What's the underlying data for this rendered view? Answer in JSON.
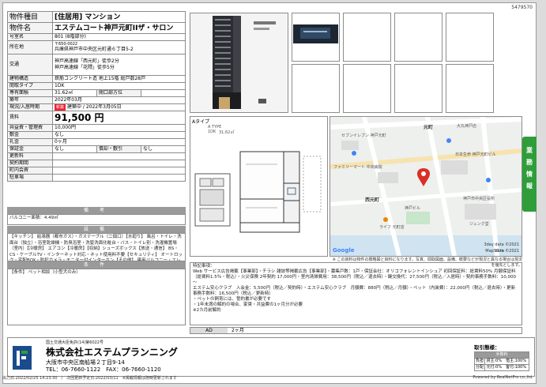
{
  "property_no": "5479570",
  "spec": {
    "type_label": "物件種目",
    "type_value": "[住居用] マンション",
    "name_label": "物件名",
    "name_value": "エステムコート神戸元町IIザ・サロン",
    "room_label": "号室名",
    "room_value": "801 (8階部分)",
    "location_label": "所在地",
    "postal": "〒650-0022",
    "location_value": "兵庫県神戸市中央区元町通６丁目5-2",
    "traffic_label": "交通",
    "traffic_1": "神戸高速線「西元町」徒歩2分",
    "traffic_2": "神戸高速線「花隈」徒歩5分",
    "structure_label": "建物構造",
    "structure_value": "鉄筋コンクリート造 地上15階 総戸数28戸",
    "layout_label": "間取タイプ",
    "layout_value": "1DK",
    "area_label": "専有面積",
    "area_value": "31.62㎡",
    "direction_label": "開口部方位",
    "direction_value": "",
    "built_label": "築年",
    "built_value": "2022年03月",
    "status_label": "現況/入居時期",
    "status_badge": "新築",
    "status_value": "建築中 / 2022年3月05日",
    "rent_label": "賃料",
    "rent_value": "91,500 円",
    "fee_label": "共益費・管理費",
    "fee_value": "10,000円",
    "deposit_label": "敷金",
    "deposit_value": "なし",
    "key_label": "礼金",
    "key_value": "0ヶ月",
    "guarantee_label": "保証金",
    "guarantee_value": "なし",
    "amort_label": "償却・敷引",
    "amort_value": "なし",
    "renewal_label": "更新料",
    "renewal_value": "",
    "contract_label": "契約期間",
    "contract_value": "",
    "neighborhood_label": "町内会費",
    "neighborhood_value": "",
    "parking_label": "駐車場",
    "parking_value": ""
  },
  "sections": {
    "remarks_title": "備 考",
    "remarks_text": "バルコニー面積：4.49㎡",
    "facilities_title": "設 備",
    "facilities_text": "【キッチン】 給湯器（都市ガス）・ガステーブル（二個口）【水廻り】 風呂・トイレ・洗面台（独立）・浴室乾燥機・防臭浴室・洗髪洗面化粧台・バス・トイレ別・洗濯機置場（室内）【冷暖房】 エアコン【冷暖房】【収納】シューズボックス【放送・通信】 BS・CS・ケーブルTV・インターネット対応・ネット使用料不要【セキュリティ】 オートロック・宅配BOX・防犯カメラ・モニター付インターホン【その他】 専用バルコニー・エレベーター・1棟・オートバイ駐輪場・自転車置場・ペット可（小型犬）・電気・ガス（都市ガス）・水道（公営）・抽水・バルコニー／ベランダ・照明・24時間換気システム・分譲タイプ・フローリング",
    "conditions_title": "条 件",
    "conditions_text": "【条件】 ペット相談（小型犬のみ）"
  },
  "floorplan": {
    "label": "Aタイプ",
    "type_caption": "A TYPE",
    "unit": "1DK",
    "area": "31.62㎡"
  },
  "map": {
    "stations": [
      "元町",
      "西元町"
    ],
    "places": [
      "日本生命 神戸元町ビル",
      "セブンイレブン 神戸元町",
      "ファミリーマート 中央病院",
      "大丸神戸店",
      "神戸市中央区役所",
      "ライフ 元町店",
      "ジュンク堂",
      "神戸ビル"
    ],
    "copyright": "Map data ©2021",
    "scale": "50 m",
    "google": "Google",
    "date_note": "3day data ©2021"
  },
  "map_note": "※ この資料は物件の概略図と資料になります。写真、間取図面、設備、概要などが現況と異なる場合は現況を優先とします。",
  "notes": {
    "heading": "特記事項：",
    "lines": [
      "Web サービス広告掲載【事業部】・チラシ 雑誌等掲載広告【事業部】・募集戸数：1戸・保証会社：オリコフォレントインシュア 初回保証料：総賃料50% 月額保証料（総賃料1.5％・税込）・火災保険 2年契約 17,000円・室内清掃費用：38,500円（税込／退去時）・鍵交換代：27,500円（税込／入居時）・契約事務手数料：10,000～",
      "エステム安心クラブ　入会金：5,500円（税込／契約時）・エステム安心クラブ　月額費：880円（税込／月額）・ペット（内装費）：22,000円（税込／退去時）・更新事務手数料：16,500円（税込／更新時）",
      "・ペットの飼育には、誓約書が必要です",
      "・1年未満の解約の場合、家賃・共益費の1ヶ月分が必要",
      "※2カ月前解約"
    ]
  },
  "ad": {
    "label": "AD",
    "value": "2ヶ月"
  },
  "side_tab": [
    "業",
    "務",
    "情",
    "報"
  ],
  "footer": {
    "license": "国土交通大臣免許(14)第6022号",
    "company": "株式会社エステムプランニング",
    "address": "大阪市中央区南船場２丁目9-14",
    "tel": "TEL：06-7660-1122　FAX：06-7660-1120"
  },
  "deal": {
    "title": "取引態様：",
    "header": "手数料",
    "row1_label": "負担",
    "row1_value": "貸主:0%　借主:100%",
    "row2_label": "分配",
    "row2_value": "元付:0%　客付:100%"
  },
  "bottom": {
    "left": "出力日:2022/02/25 14:23:30　/　次回更新予定日:2022/03/11　※掲載情報は随時更新されます",
    "right": "Powered by RealNetPro co.,ltd."
  },
  "colors": {
    "accent_green": "#2f9e3a",
    "new_badge": "#e23",
    "header_gray": "#9a9a9a",
    "map_pin": "#d93025"
  }
}
